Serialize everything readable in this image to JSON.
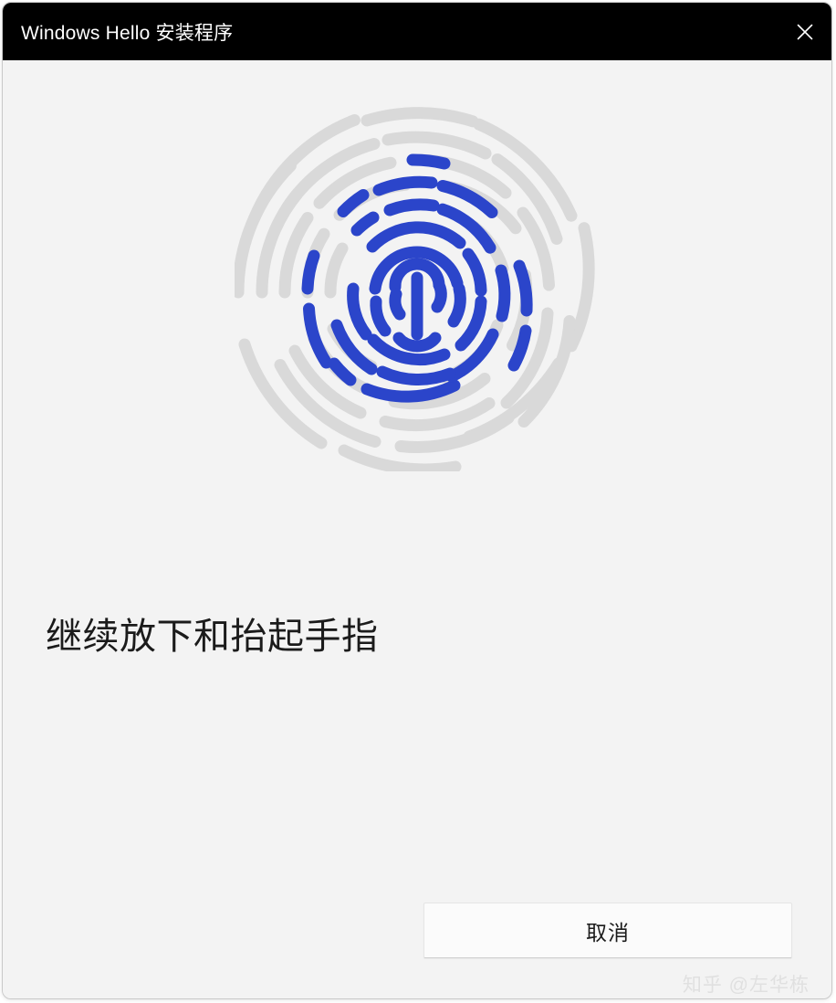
{
  "window": {
    "title": "Windows Hello 安装程序",
    "close_icon": "close-icon",
    "titlebar_bg": "#000000",
    "body_bg": "#f3f3f3"
  },
  "main": {
    "graphic": {
      "icon_name": "fingerprint-icon",
      "progress_color": "#2b45ca",
      "track_color": "#d9d9d9"
    },
    "heading": "继续放下和抬起手指"
  },
  "footer": {
    "cancel_label": "取消"
  },
  "watermark": {
    "text": "知乎 @左华栋"
  }
}
